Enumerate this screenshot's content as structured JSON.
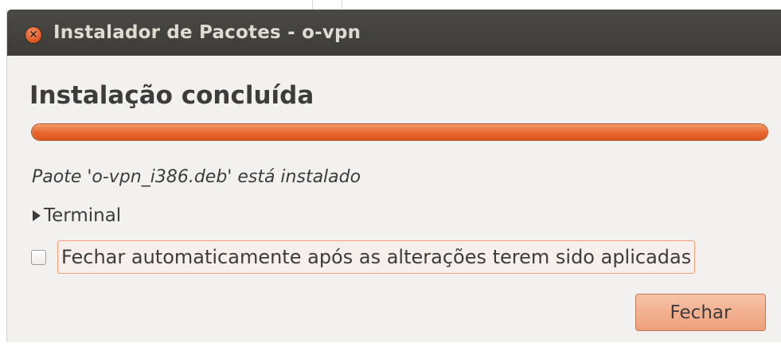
{
  "window": {
    "title": "Instalador de Pacotes - o-vpn",
    "close_icon": "close-icon"
  },
  "main": {
    "heading": "Instalação concluída",
    "progress": {
      "percent": 100,
      "color": "#e8672e"
    },
    "status": "Paote 'o-vpn_i386.deb' está instalado",
    "expander": {
      "label": "Terminal",
      "expanded": false,
      "icon": "triangle-right-icon"
    },
    "auto_close": {
      "label": "Fechar automaticamente após as alterações terem sido aplicadas",
      "checked": false
    },
    "close_button": {
      "label": "Fechar"
    }
  }
}
